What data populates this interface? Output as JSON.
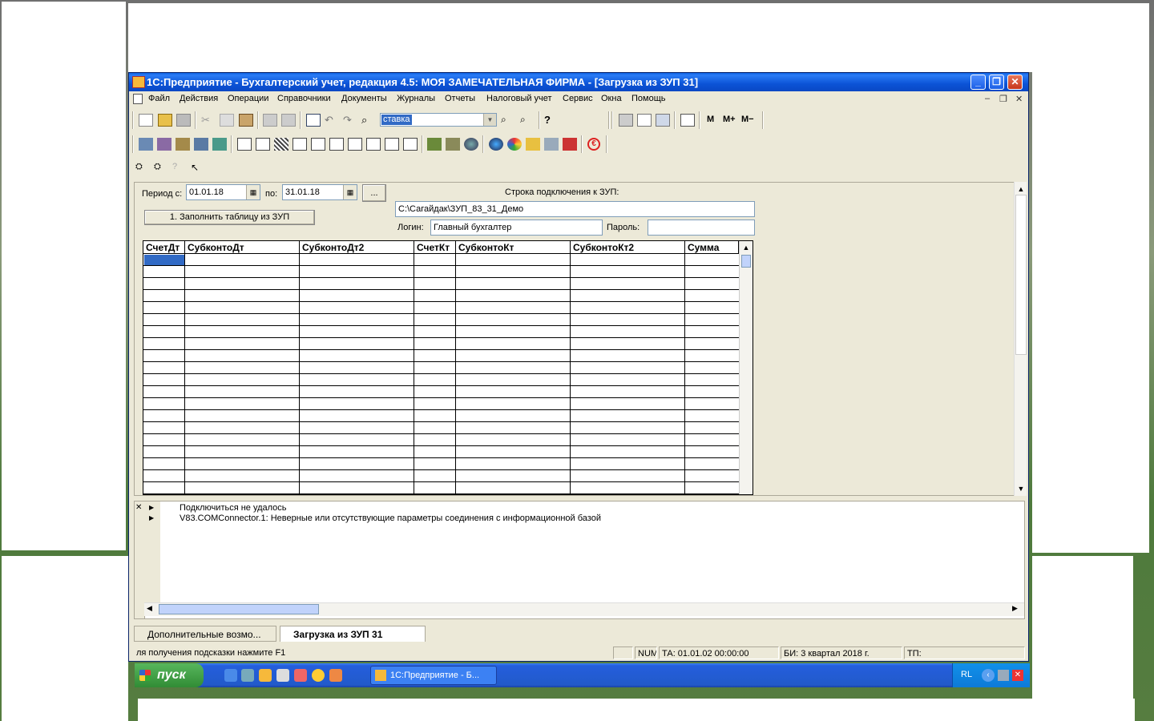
{
  "window": {
    "title": "1С:Предприятие - Бухгалтерский учет, редакция 4.5: МОЯ ЗАМЕЧАТЕЛЬНАЯ ФИРМА - [Загрузка из ЗУП 31]",
    "minimize": "_",
    "restore": "❐",
    "close": "✕"
  },
  "menu": {
    "items": [
      "Файл",
      "Действия",
      "Операции",
      "Справочники",
      "Документы",
      "Журналы",
      "Отчеты",
      "Налоговый учет",
      "Сервис",
      "Окна",
      "Помощь"
    ]
  },
  "toolbar": {
    "search_value": "ставка",
    "calc_labels": [
      "M",
      "M+",
      "M−"
    ]
  },
  "form": {
    "period_from_label": "Период с:",
    "period_from": "01.01.18",
    "period_to_label": "по:",
    "period_to": "31.01.18",
    "ellipsis": "...",
    "connection_label": "Строка подключения к ЗУП:",
    "connection_value": "C:\\Сагайдак\\ЗУП_83_31_Демо",
    "login_label": "Логин:",
    "login_value": "Главный бухгалтер",
    "password_label": "Пароль:",
    "password_value": "",
    "fill_button": "1. Заполнить таблицу из ЗУП"
  },
  "grid": {
    "columns": [
      "СчетДт",
      "СубконтоДт",
      "СубконтоДт2",
      "СчетКт",
      "СубконтоКт",
      "СубконтоКт2",
      "Сумма"
    ]
  },
  "messages": {
    "lines": [
      "Подключиться не удалось",
      "V83.COMConnector.1: Неверные или отсутствующие параметры соединения с информационной базой"
    ]
  },
  "tabs": [
    {
      "label": "Дополнительные возмо..."
    },
    {
      "label": "Загрузка из ЗУП 31"
    }
  ],
  "status": {
    "hint": "ля получения подсказки нажмите F1",
    "num": "NUM",
    "ta": "ТА: 01.01.02  00:00:00",
    "bi": "БИ: 3 квартал 2018 г.",
    "tp": "ТП:"
  },
  "taskbar": {
    "start_label": "пуск",
    "task_label": "1С:Предприятие - Б...",
    "tray_lang": "RL"
  }
}
